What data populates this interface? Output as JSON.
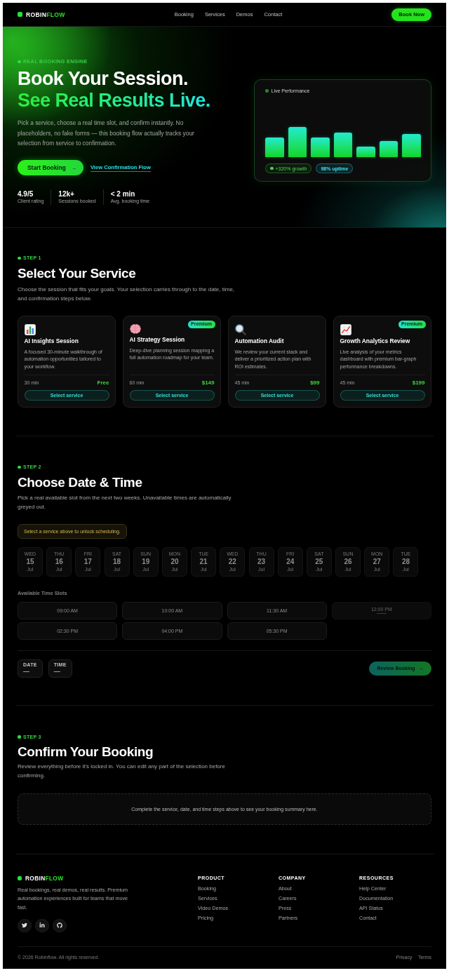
{
  "nav": {
    "brand": {
      "first": "ROBIN",
      "second": "FLOW"
    },
    "links": [
      "Booking",
      "Services",
      "Demos",
      "Contact"
    ],
    "cta": "Book Now"
  },
  "hero": {
    "eyebrow": "REAL BOOKING ENGINE",
    "title": "Book Your Session.",
    "highlight": "See Real Results Live.",
    "text": "Pick a service, choose a real time slot, and confirm instantly. No placeholders, no fake forms — this booking flow actually tracks your selection from service to confirmation.",
    "primary_button": {
      "label": "Start Booking",
      "arrow": "→"
    },
    "secondary_link": "View Confirmation Flow",
    "stats": [
      {
        "value": "4.9/5",
        "label": "Client rating"
      },
      {
        "value": "12k+",
        "label": "Sessions booked"
      },
      {
        "value": "< 2 min",
        "label": "Avg. booking time"
      }
    ],
    "performance": {
      "title": "Live Performance",
      "badges": [
        {
          "kind": "growth",
          "text": "+320% growth"
        },
        {
          "kind": "uptime",
          "text": "98% uptime"
        }
      ]
    }
  },
  "service_step": {
    "step": "STEP 1",
    "title": "Select Your Service",
    "text": "Choose the session that fits your goals. Your selection carries through to the date, time, and confirmation steps below.",
    "services": [
      {
        "name": "AI Insights Session",
        "description": "A focused 30-minute walkthrough of automation opportunities tailored to your workflow.",
        "duration": "30 min",
        "price": "Free",
        "button": "Select service",
        "selected": false
      },
      {
        "badge": "Premium",
        "name": "AI Strategy Session",
        "description": "Deep-dive planning session mapping a full automation roadmap for your team.",
        "duration": "60 min",
        "price": "$149",
        "button": "Select service",
        "selected": false
      },
      {
        "name": "Automation Audit",
        "description": "We review your current stack and deliver a prioritized action plan with ROI estimates.",
        "duration": "45 min",
        "price": "$99",
        "button": "Select service",
        "selected": false
      },
      {
        "badge": "Premium",
        "name": "Growth Analytics Review",
        "description": "Live analysis of your metrics dashboard with premium bar-graph performance breakdowns.",
        "duration": "45 min",
        "price": "$199",
        "button": "Select service",
        "selected": false
      }
    ]
  },
  "scheduling": {
    "step": "STEP 2",
    "title": "Choose Date & Time",
    "text": "Pick a real available slot from the next two weeks. Unavailable times are automatically greyed out.",
    "notice": "Select a service above to unlock scheduling.",
    "dates": [
      {
        "weekday": "WED",
        "day": "15",
        "month": "Jul",
        "disabled": true,
        "selected": false
      },
      {
        "weekday": "THU",
        "day": "16",
        "month": "Jul",
        "disabled": true,
        "selected": false
      },
      {
        "weekday": "FRI",
        "day": "17",
        "month": "Jul",
        "disabled": true,
        "selected": false
      },
      {
        "weekday": "SAT",
        "day": "18",
        "month": "Jul",
        "disabled": true,
        "selected": false
      },
      {
        "weekday": "SUN",
        "day": "19",
        "month": "Jul",
        "disabled": true,
        "selected": false
      },
      {
        "weekday": "MON",
        "day": "20",
        "month": "Jul",
        "disabled": true,
        "selected": false
      },
      {
        "weekday": "TUE",
        "day": "21",
        "month": "Jul",
        "disabled": true,
        "selected": false
      },
      {
        "weekday": "WED",
        "day": "22",
        "month": "Jul",
        "disabled": true,
        "selected": false
      },
      {
        "weekday": "THU",
        "day": "23",
        "month": "Jul",
        "disabled": true,
        "selected": false
      },
      {
        "weekday": "FRI",
        "day": "24",
        "month": "Jul",
        "disabled": true,
        "selected": false
      },
      {
        "weekday": "SAT",
        "day": "25",
        "month": "Jul",
        "disabled": true,
        "selected": false
      },
      {
        "weekday": "SUN",
        "day": "26",
        "month": "Jul",
        "disabled": true,
        "selected": false
      },
      {
        "weekday": "MON",
        "day": "27",
        "month": "Jul",
        "disabled": true,
        "selected": false
      },
      {
        "weekday": "TUE",
        "day": "28",
        "month": "Jul",
        "disabled": true,
        "selected": false
      }
    ],
    "slots_heading": "Available Time Slots",
    "time_slots": [
      {
        "time": "09:00 AM",
        "available": true,
        "selected": false
      },
      {
        "time": "10:00 AM",
        "available": true,
        "selected": false
      },
      {
        "time": "11:30 AM",
        "available": true,
        "selected": false
      },
      {
        "time": "12:00 PM",
        "available": false,
        "selected": false
      },
      {
        "time": "02:30 PM",
        "available": true,
        "selected": false
      },
      {
        "time": "04:00 PM",
        "available": true,
        "selected": false
      },
      {
        "time": "05:30 PM",
        "available": true,
        "selected": false
      }
    ],
    "summary": [
      {
        "label": "DATE",
        "value": "—"
      },
      {
        "label": "TIME",
        "value": "—"
      }
    ],
    "review_button": {
      "label": "Review Booking",
      "arrow": "→",
      "disabled": true
    }
  },
  "confirmation": {
    "step": "STEP 3",
    "title": "Confirm Your Booking",
    "text": "Review everything before it's locked in. You can edit any part of the selection before confirming.",
    "empty_message": "Complete the service, date, and time steps above to see your booking summary here."
  },
  "footer": {
    "brand": {
      "first": "ROBIN",
      "second": "FLOW"
    },
    "text": "Real bookings, real demos, real results. Premium automation experiences built for teams that move fast.",
    "columns": [
      {
        "heading": "PRODUCT",
        "links": [
          "Booking",
          "Services",
          "Video Demos",
          "Pricing"
        ]
      },
      {
        "heading": "COMPANY",
        "links": [
          "About",
          "Careers",
          "Press",
          "Partners"
        ]
      },
      {
        "heading": "RESOURCES",
        "links": [
          "Help Center",
          "Documentation",
          "API Status",
          "Contact"
        ]
      }
    ],
    "copyright": "© 2026 Robinflow. All rights reserved.",
    "legal_links": [
      "Privacy",
      "Terms"
    ]
  }
}
